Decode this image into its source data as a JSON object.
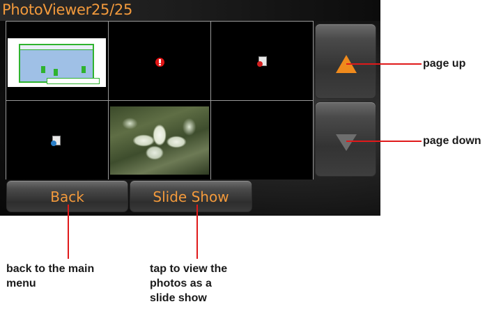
{
  "app": {
    "title": "PhotoViewer25/25"
  },
  "grid": {
    "cells": [
      {
        "kind": "screenshot-thumbnail"
      },
      {
        "kind": "error-icon"
      },
      {
        "kind": "file-icon-red"
      },
      {
        "kind": "file-icon-blue"
      },
      {
        "kind": "photo-thumbnail"
      },
      {
        "kind": "empty"
      }
    ]
  },
  "buttons": {
    "page_up_icon": "triangle-up-icon",
    "page_down_icon": "triangle-down-icon",
    "back_label": "Back",
    "slideshow_label": "Slide Show"
  },
  "callouts": {
    "page_up": "page up",
    "page_down": "page down",
    "back_line1": "back to the main",
    "back_line2": "menu",
    "slideshow_line1": "tap to view the",
    "slideshow_line2": "photos as a",
    "slideshow_line3": "slide show"
  },
  "colors": {
    "accent": "#f39a3c",
    "callout_line": "#e0191a"
  }
}
